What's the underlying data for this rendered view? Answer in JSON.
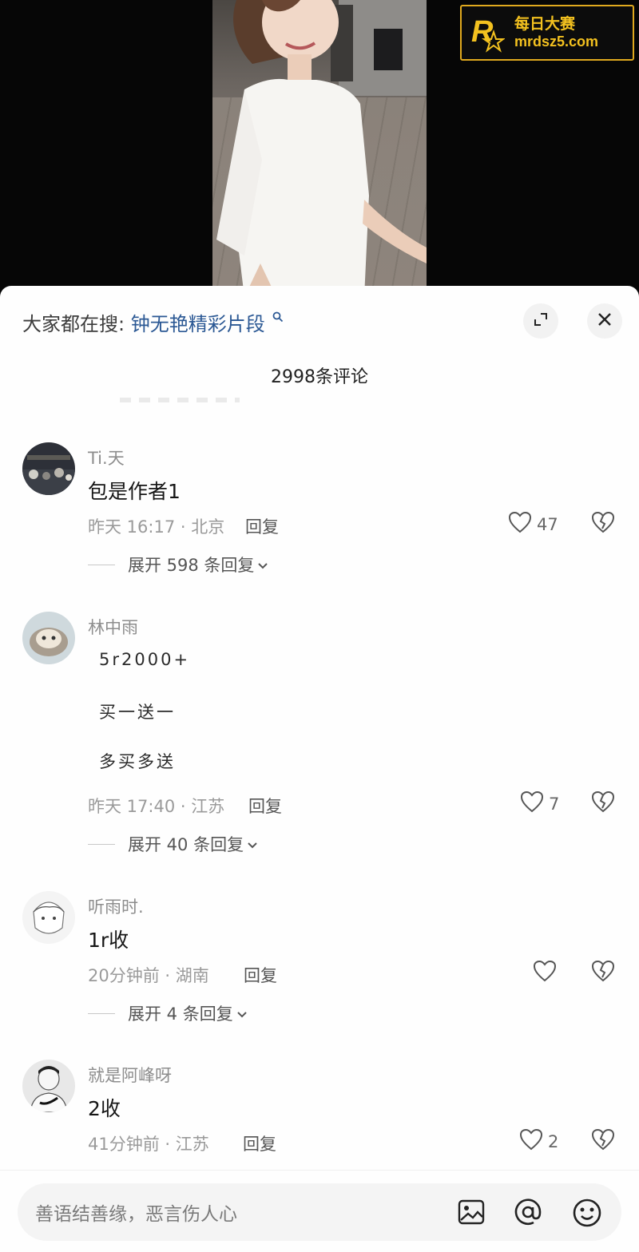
{
  "watermark": {
    "cn": "每日大赛",
    "en": "mrdsz5.com"
  },
  "search": {
    "prefix": "大家都在搜:",
    "query": "钟无艳精彩片段"
  },
  "comment_count": "2998条评论",
  "comments": [
    {
      "username": "Ti.天",
      "content": "包是作者1",
      "time": "昨天 16:17",
      "location": "北京",
      "reply_label": "回复",
      "likes": "47",
      "expand_label": "展开 598 条回复"
    },
    {
      "username": "林中雨",
      "lines": [
        "5r2000+",
        "买一送一",
        "多买多送"
      ],
      "time": "昨天 17:40",
      "location": "江苏",
      "reply_label": "回复",
      "likes": "7",
      "expand_label": "展开 40 条回复"
    },
    {
      "username": "听雨时.",
      "content": "1r收",
      "time": "20分钟前",
      "location": "湖南",
      "reply_label": "回复",
      "likes": "",
      "expand_label": "展开 4 条回复"
    },
    {
      "username": "就是阿峰呀",
      "content": "2收",
      "time": "41分钟前",
      "location": "江苏",
      "reply_label": "回复",
      "likes": "2"
    }
  ],
  "input": {
    "placeholder": "善语结善缘，恶言伤人心"
  },
  "icons": {
    "expand": "expand-icon",
    "close": "close-icon",
    "search": "search-icon",
    "like": "heart-icon",
    "dislike": "broken-heart-icon",
    "image": "image-icon",
    "mention": "at-icon",
    "emoji": "emoji-icon",
    "chevron": "chevron-down-icon"
  },
  "colors": {
    "query_link": "#2b5894",
    "watermark": "#f3c11f",
    "panel_bg": "#fefefe"
  }
}
